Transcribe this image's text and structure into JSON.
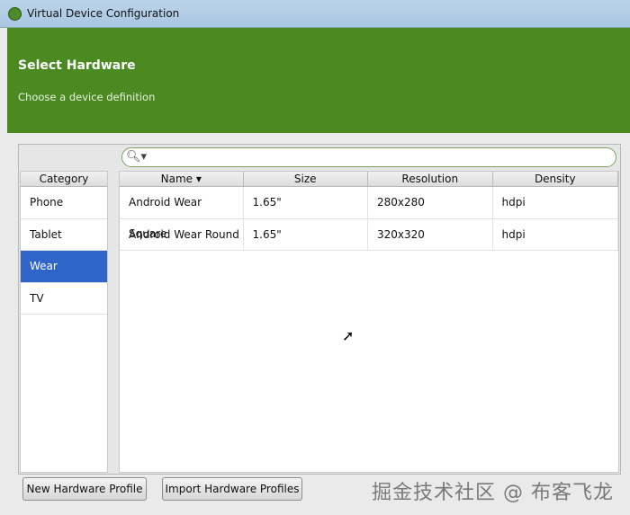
{
  "window": {
    "title": "Virtual Device Configuration"
  },
  "header": {
    "title": "Select Hardware",
    "subtitle": "Choose a device definition"
  },
  "search": {
    "icon": "search-icon",
    "value": ""
  },
  "category": {
    "header": "Category",
    "items": [
      {
        "label": "Phone"
      },
      {
        "label": "Tablet"
      },
      {
        "label": "Wear",
        "selected": true
      },
      {
        "label": "TV"
      }
    ]
  },
  "table": {
    "columns": [
      "Name ▾",
      "Size",
      "Resolution",
      "Density"
    ],
    "rows": [
      [
        "Android Wear Square",
        "1.65\"",
        "280x280",
        "hdpi"
      ],
      [
        "Android Wear Round",
        "1.65\"",
        "320x320",
        "hdpi"
      ]
    ]
  },
  "buttons": {
    "new": "New Hardware Profile",
    "import": "Import Hardware Profiles"
  },
  "watermark": "掘金技术社区 @ 布客飞龙",
  "colors": {
    "header": "#4b8a21",
    "selection": "#2f64c8"
  }
}
